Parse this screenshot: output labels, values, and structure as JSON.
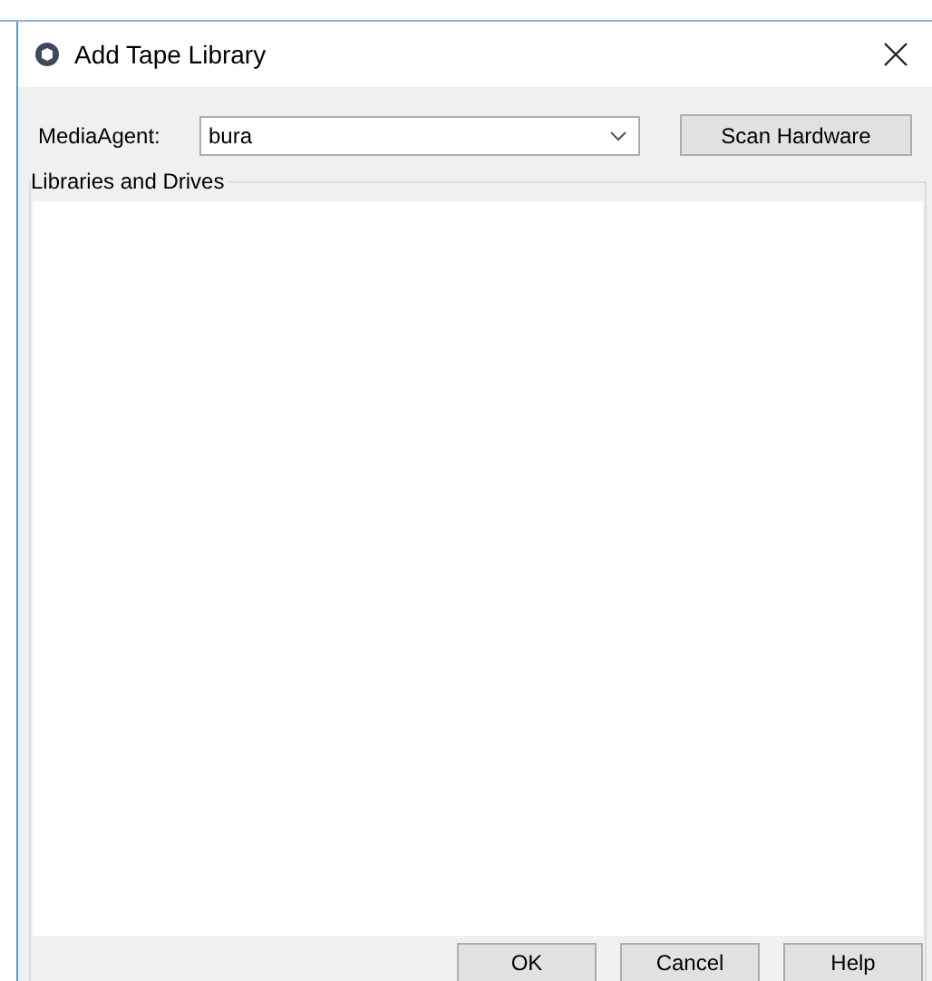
{
  "window": {
    "title": "Add Tape Library"
  },
  "media_agent": {
    "label": "MediaAgent:",
    "value": "bura"
  },
  "scan_button": "Scan Hardware",
  "group": {
    "label": "Libraries and Drives"
  },
  "buttons": [
    "OK",
    "Cancel",
    "Help"
  ]
}
